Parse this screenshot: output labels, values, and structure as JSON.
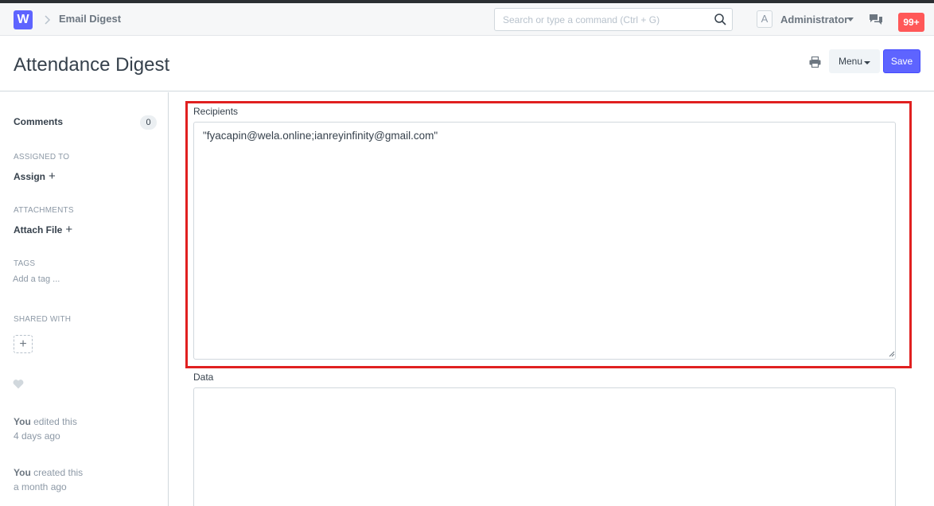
{
  "navbar": {
    "logo_letter": "W",
    "breadcrumb": "Email Digest",
    "search_placeholder": "Search or type a command (Ctrl + G)",
    "avatar_initial": "A",
    "user_name": "Administrator",
    "notifications": "99+"
  },
  "page": {
    "title": "Attendance Digest",
    "menu_label": "Menu",
    "save_label": "Save"
  },
  "sidebar": {
    "comments_label": "Comments",
    "comments_count": "0",
    "assigned_heading": "ASSIGNED TO",
    "assign_label": "Assign",
    "attachments_heading": "ATTACHMENTS",
    "attach_label": "Attach File",
    "tags_heading": "TAGS",
    "add_tag": "Add a tag ...",
    "shared_heading": "SHARED WITH",
    "activity": [
      {
        "actor": "You",
        "action": "edited this",
        "when": "4 days ago"
      },
      {
        "actor": "You",
        "action": "created this",
        "when": "a month ago"
      }
    ]
  },
  "form": {
    "recipients_label": "Recipients",
    "recipients_value": "\"fyacapin@wela.online;ianreyinfinity@gmail.com\"",
    "data_label": "Data",
    "data_value": ""
  },
  "colors": {
    "brand": "#5e64ff",
    "highlight": "#e02020",
    "badge": "#ff5858"
  }
}
